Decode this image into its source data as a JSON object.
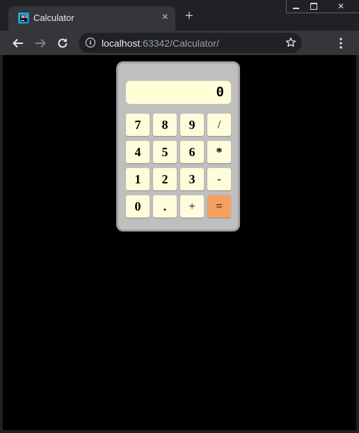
{
  "browser": {
    "tab": {
      "title": "Calculator",
      "favicon_text": "WS",
      "close_label": "×"
    },
    "new_tab_label": "+",
    "window_controls": {
      "close_label": "✕"
    },
    "address_bar": {
      "host": "localhost",
      "path": ":63342/Calculator/"
    }
  },
  "calculator": {
    "display": "0",
    "keys": {
      "k7": "7",
      "k8": "8",
      "k9": "9",
      "divide": "/",
      "k4": "4",
      "k5": "5",
      "k6": "6",
      "multiply": "*",
      "k1": "1",
      "k2": "2",
      "k3": "3",
      "minus": "-",
      "k0": "0",
      "dot": ".",
      "plus": "+",
      "equals": "="
    }
  },
  "colors": {
    "page_background": "#000000",
    "calculator_body": "#bfbfbf",
    "display_background": "#ffffd7",
    "key_background": "#fffcdb",
    "equals_key": "#f6a060"
  },
  "icons": [
    "back-arrow-icon",
    "forward-arrow-icon",
    "reload-icon",
    "info-icon",
    "star-icon",
    "menu-dots-icon"
  ]
}
